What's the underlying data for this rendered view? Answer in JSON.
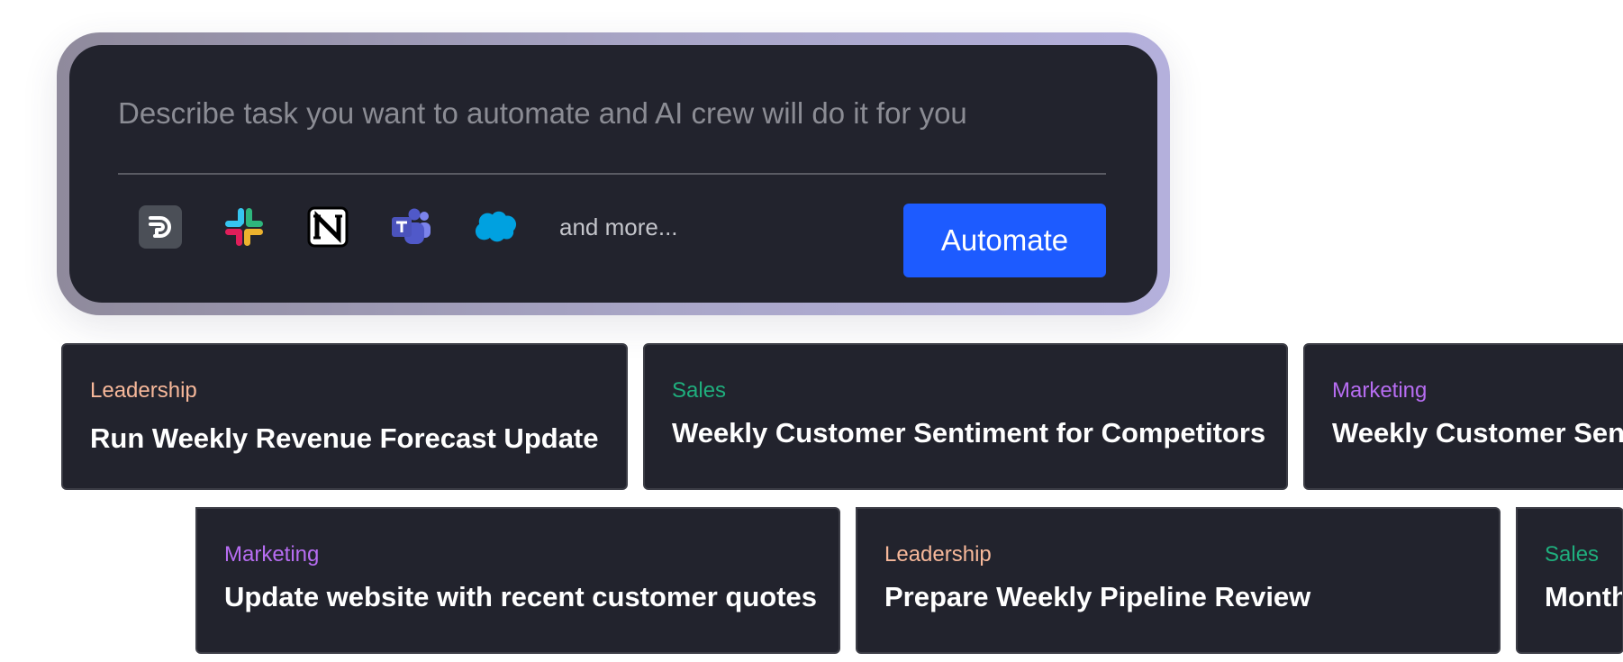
{
  "prompt": {
    "placeholder": "Describe task you want to automate and AI crew will do it for you",
    "value": ""
  },
  "integrations": {
    "icons": [
      "dialpad-icon",
      "slack-icon",
      "notion-icon",
      "teams-icon",
      "salesforce-icon"
    ],
    "more_label": "and more..."
  },
  "automate_button": {
    "label": "Automate"
  },
  "colors": {
    "accent": "#1d5bff",
    "card_bg": "#22232d",
    "leadership": "#f7b89a",
    "sales": "#1fae7d",
    "marketing": "#b76df2"
  },
  "templates": {
    "row1": [
      {
        "category": "Leadership",
        "title": "Run Weekly Revenue Forecast Update"
      },
      {
        "category": "Sales",
        "title": "Weekly Customer Sentiment for Competitors"
      },
      {
        "category": "Marketing",
        "title": "Weekly Customer Sent"
      }
    ],
    "row2": [
      {
        "category": "Marketing",
        "title": "Update website with recent customer quotes"
      },
      {
        "category": "Leadership",
        "title": "Prepare Weekly Pipeline Review"
      },
      {
        "category": "Sales",
        "title": "Month"
      }
    ]
  }
}
